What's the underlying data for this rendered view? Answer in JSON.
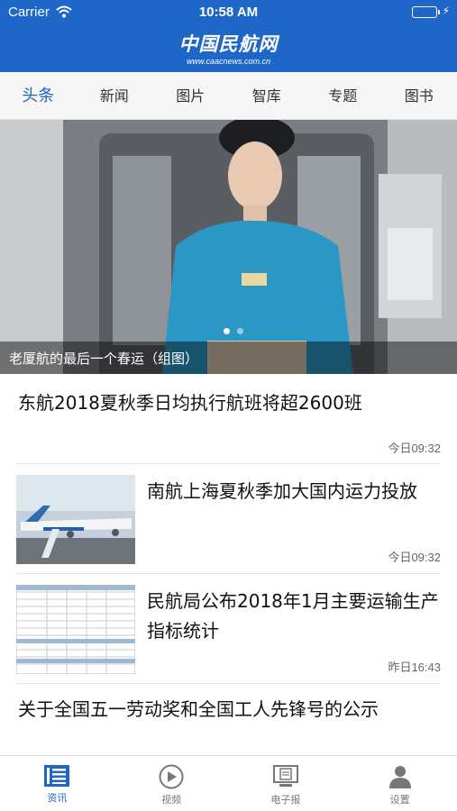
{
  "status_bar": {
    "carrier": "Carrier",
    "time": "10:58 AM"
  },
  "header": {
    "title": "中国民航网",
    "subtitle": "www.caacnews.com.cn"
  },
  "tabs": [
    {
      "label": "头条",
      "active": true
    },
    {
      "label": "新闻"
    },
    {
      "label": "图片"
    },
    {
      "label": "智库"
    },
    {
      "label": "专题"
    },
    {
      "label": "图书"
    }
  ],
  "hero": {
    "caption": "老厦航的最后一个春运（组图）",
    "slide_count": 2,
    "active_slide": 1
  },
  "news": [
    {
      "title": "东航2018夏秋季日均执行航班将超2600班",
      "time": "今日09:32"
    },
    {
      "title": "南航上海夏秋季加大国内运力投放",
      "time": "今日09:32",
      "thumb": "airplane-photo"
    },
    {
      "title": "民航局公布2018年1月主要运输生产指标统计",
      "time": "昨日16:43",
      "thumb": "statistics-table"
    },
    {
      "title": "关于全国五一劳动奖和全国工人先锋号的公示"
    }
  ],
  "bottom_nav": [
    {
      "label": "资讯",
      "icon": "news-icon",
      "active": true
    },
    {
      "label": "视频",
      "icon": "play-icon"
    },
    {
      "label": "电子报",
      "icon": "newspaper-icon"
    },
    {
      "label": "设置",
      "icon": "user-icon"
    }
  ],
  "colors": {
    "brand": "#1f66c9",
    "tab_bg": "#f6f6f6",
    "battery": "#5ed05a"
  }
}
